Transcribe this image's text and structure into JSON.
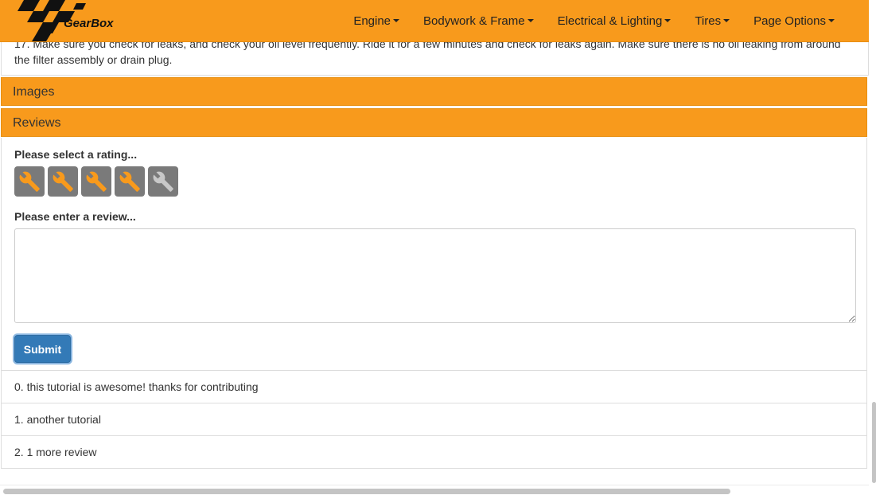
{
  "navbar": {
    "brand": "GearBox",
    "menu": [
      {
        "label": "Engine"
      },
      {
        "label": "Bodywork & Frame"
      },
      {
        "label": "Electrical & Lighting"
      },
      {
        "label": "Tires"
      },
      {
        "label": "Page Options"
      }
    ]
  },
  "step": {
    "text": "17. Make sure you check for leaks, and check your oil level frequently. Ride it for a few minutes and check for leaks again. Make sure there is no oil leaking from around the filter assembly or drain plug."
  },
  "panels": {
    "images_title": "Images",
    "reviews_title": "Reviews"
  },
  "reviews_form": {
    "rating_label": "Please select a rating...",
    "rating": {
      "value": 4,
      "max": 5
    },
    "review_label": "Please enter a review...",
    "review_value": "",
    "submit_label": "Submit"
  },
  "reviews": [
    {
      "text": "0. this tutorial is awesome! thanks for contributing"
    },
    {
      "text": "1. another tutorial"
    },
    {
      "text": "2. 1 more review"
    }
  ],
  "colors": {
    "brand_orange": "#f89a1c",
    "wrench_active": "#f89a1c",
    "wrench_inactive": "#c8c8c8",
    "primary_button": "#337ab7"
  }
}
